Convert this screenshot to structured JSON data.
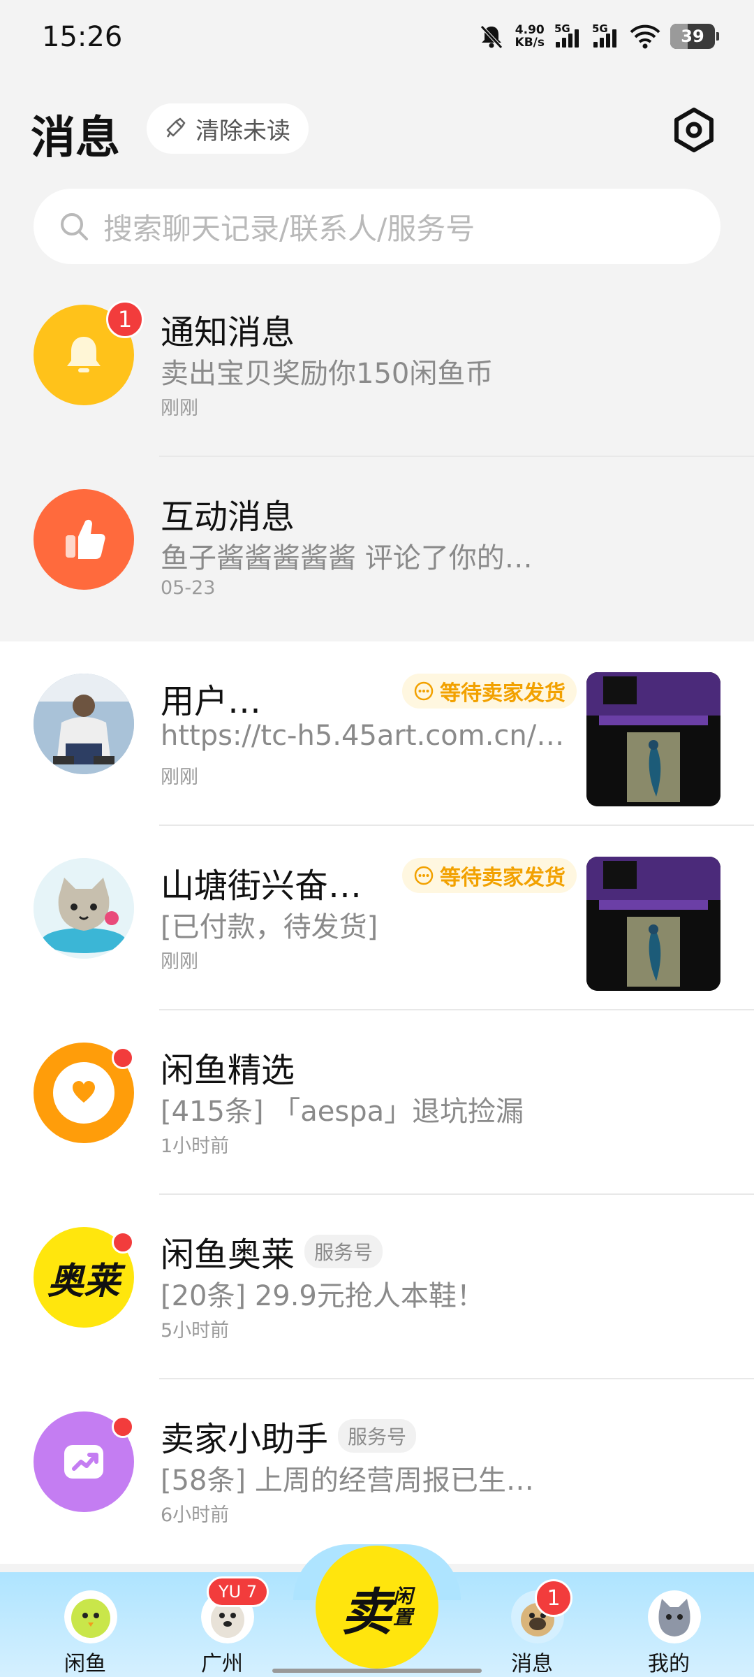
{
  "status_bar": {
    "time": "15:26",
    "net_speed_value": "4.90",
    "net_speed_unit": "KB/s",
    "sim1": "5G",
    "sim2": "5G",
    "battery": "39"
  },
  "header": {
    "title": "消息",
    "clear_unread": "清除未读"
  },
  "search": {
    "placeholder": "搜索聊天记录/联系人/服务号"
  },
  "conversations": [
    {
      "title": "通知消息",
      "subtitle": "卖出宝贝奖励你150闲鱼币",
      "time": "刚刚",
      "badge": "1",
      "avatar_color": "#ffc21a",
      "icon": "bell-icon"
    },
    {
      "title": "互动消息",
      "subtitle": "鱼子酱酱酱酱酱 评论了你的…",
      "time": "05-23",
      "avatar_color": "#ff6a3d",
      "icon": "thumbs-up-icon"
    },
    {
      "title": "用户…",
      "subtitle": "https://tc-h5.45art.com.cn/…",
      "time": "刚刚",
      "status": "等待卖家发货"
    },
    {
      "title": "山塘街兴奋…",
      "subtitle": "[已付款，待发货]",
      "time": "刚刚",
      "status": "等待卖家发货"
    },
    {
      "title": "闲鱼精选",
      "subtitle": "[415条] 「aespa」退坑捡漏",
      "time": "1小时前",
      "avatar_color": "#ff9d0a",
      "icon": "heart-icon"
    },
    {
      "title": "闲鱼奥莱",
      "tag": "服务号",
      "subtitle": "[20条] 29.9元抢人本鞋！",
      "time": "5小时前",
      "avatar_color": "#ffe60d",
      "logo_text": "奥莱"
    },
    {
      "title": "卖家小助手",
      "tag": "服务号",
      "subtitle": "[58条] 上周的经营周报已生…",
      "time": "6小时前",
      "avatar_color": "#c47df2",
      "icon": "trend-chart-icon"
    }
  ],
  "bottom_nav": {
    "items": [
      "闲鱼",
      "广州",
      "消息",
      "我的"
    ],
    "yu_badge": "YU 7",
    "msg_badge": "1",
    "sell_big": "卖",
    "sell_small_1": "闲",
    "sell_small_2": "置"
  }
}
